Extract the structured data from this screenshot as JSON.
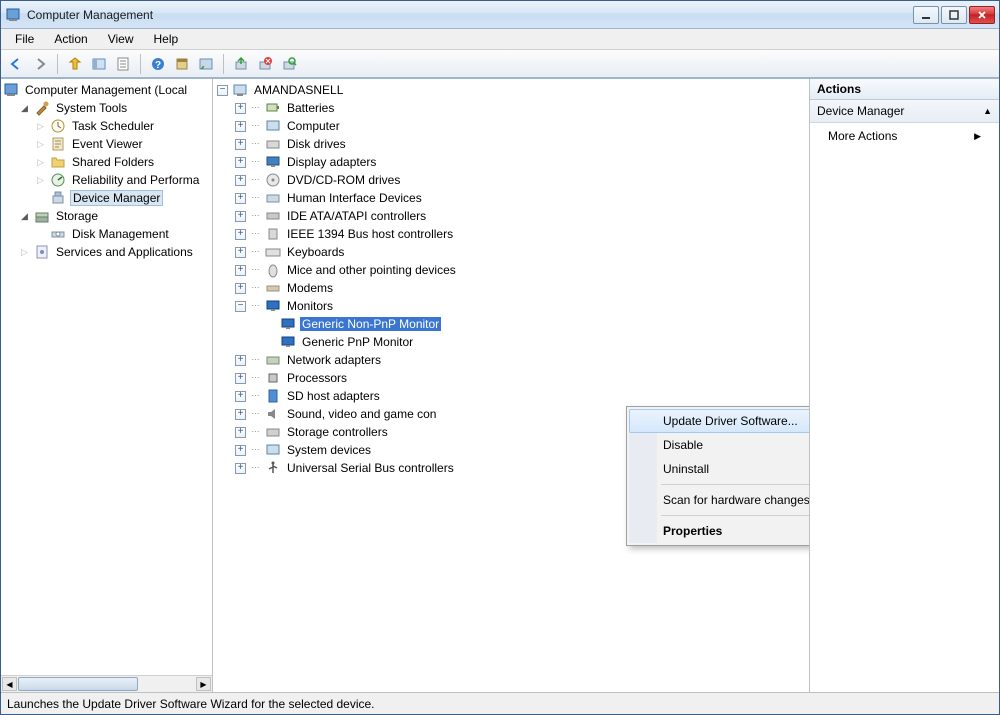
{
  "window": {
    "title": "Computer Management"
  },
  "menubar": [
    "File",
    "Action",
    "View",
    "Help"
  ],
  "left_tree": {
    "root": "Computer Management (Local",
    "system_tools": "System Tools",
    "system_items": [
      "Task Scheduler",
      "Event Viewer",
      "Shared Folders",
      "Reliability and Performa"
    ],
    "device_manager": "Device Manager",
    "storage": "Storage",
    "disk_mgmt": "Disk Management",
    "services": "Services and Applications"
  },
  "devices": {
    "root": "AMANDASNELL",
    "items": [
      "Batteries",
      "Computer",
      "Disk drives",
      "Display adapters",
      "DVD/CD-ROM drives",
      "Human Interface Devices",
      "IDE ATA/ATAPI controllers",
      "IEEE 1394 Bus host controllers",
      "Keyboards",
      "Mice and other pointing devices",
      "Modems"
    ],
    "monitors": "Monitors",
    "monitor_items": [
      "Generic Non-PnP Monitor",
      "Generic PnP Monitor"
    ],
    "after": [
      "Network adapters",
      "Processors",
      "SD host adapters",
      "Sound, video and game con",
      "Storage controllers",
      "System devices",
      "Universal Serial Bus controllers"
    ]
  },
  "context_menu": {
    "update": "Update Driver Software...",
    "disable": "Disable",
    "uninstall": "Uninstall",
    "scan": "Scan for hardware changes",
    "properties": "Properties"
  },
  "actions": {
    "header": "Actions",
    "subheader": "Device Manager",
    "more": "More Actions"
  },
  "status": "Launches the Update Driver Software Wizard for the selected device."
}
